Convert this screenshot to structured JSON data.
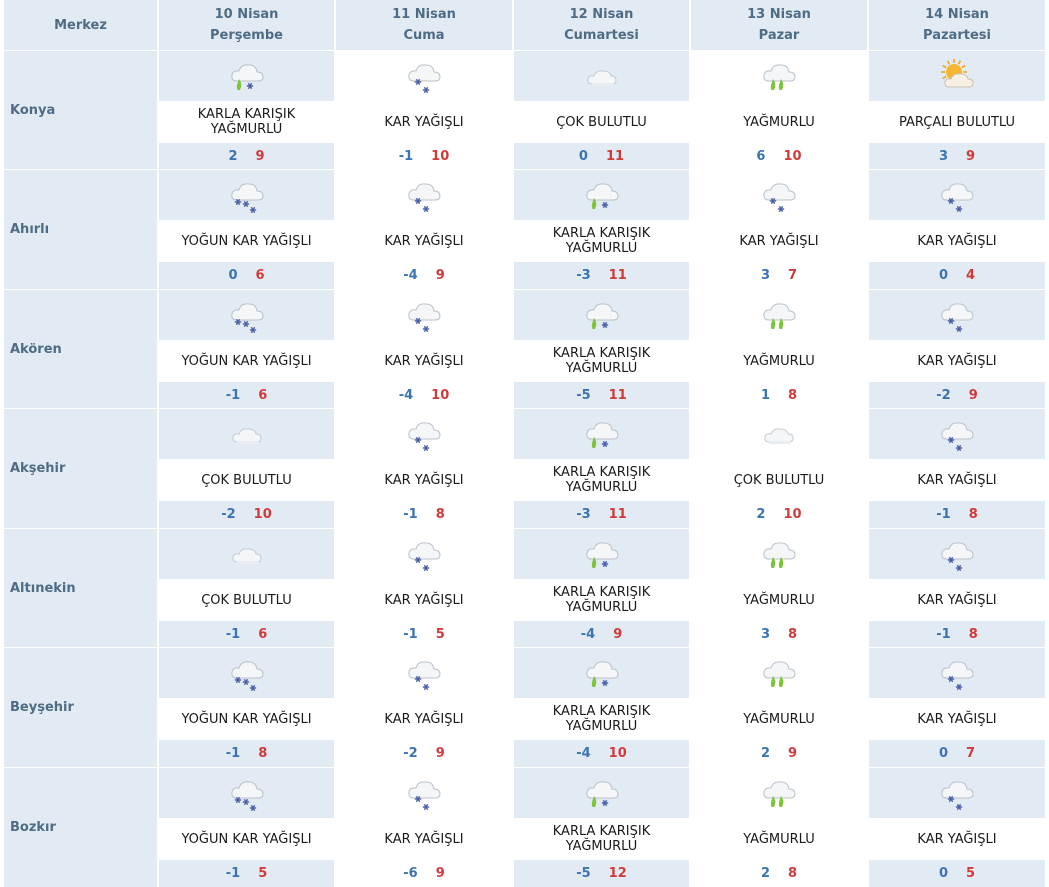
{
  "header": {
    "corner_label": "Merkez",
    "days": [
      {
        "date": "10 Nisan",
        "weekday": "Perşembe"
      },
      {
        "date": "11 Nisan",
        "weekday": "Cuma"
      },
      {
        "date": "12 Nisan",
        "weekday": "Cumartesi"
      },
      {
        "date": "13 Nisan",
        "weekday": "Pazar"
      },
      {
        "date": "14 Nisan",
        "weekday": "Pazartesi"
      }
    ]
  },
  "conditions": {
    "sleet": "KARLA KARIŞIK YAĞMURLU",
    "snow": "KAR YAĞIŞLI",
    "heavy_snow": "YOĞUN KAR YAĞIŞLI",
    "overcast": "ÇOK BULUTLU",
    "rain": "YAĞMURLU",
    "partly_cloudy": "PARÇALI BULUTLU"
  },
  "icons": {
    "sleet": "cloud-rain-snow-icon",
    "snow": "cloud-snow-icon",
    "heavy_snow": "cloud-heavy-snow-icon",
    "overcast": "cloud-icon",
    "rain": "cloud-rain-icon",
    "partly_cloudy": "sun-cloud-icon"
  },
  "colors": {
    "header_bg": "#e2ebf3",
    "header_text": "#4f6c86",
    "min_temp": "#3a74b3",
    "max_temp": "#d23a3a",
    "rain_drop": "#7cc43a",
    "snowflake": "#4a5fa6",
    "sun": "#f5a623"
  },
  "cities": [
    {
      "name": "Konya",
      "days": [
        {
          "cond": "KARLA KARIŞIK YAĞMURLU",
          "icon": "sleet",
          "min": "2",
          "max": "9"
        },
        {
          "cond": "KAR YAĞIŞLI",
          "icon": "snow",
          "min": "-1",
          "max": "10"
        },
        {
          "cond": "ÇOK BULUTLU",
          "icon": "overcast",
          "min": "0",
          "max": "11"
        },
        {
          "cond": "YAĞMURLU",
          "icon": "rain",
          "min": "6",
          "max": "10"
        },
        {
          "cond": "PARÇALI BULUTLU",
          "icon": "partly_cloudy",
          "min": "3",
          "max": "9"
        }
      ]
    },
    {
      "name": "Ahırlı",
      "days": [
        {
          "cond": "YOĞUN KAR YAĞIŞLI",
          "icon": "heavy_snow",
          "min": "0",
          "max": "6"
        },
        {
          "cond": "KAR YAĞIŞLI",
          "icon": "snow",
          "min": "-4",
          "max": "9"
        },
        {
          "cond": "KARLA KARIŞIK YAĞMURLU",
          "icon": "sleet",
          "min": "-3",
          "max": "11"
        },
        {
          "cond": "KAR YAĞIŞLI",
          "icon": "snow",
          "min": "3",
          "max": "7"
        },
        {
          "cond": "KAR YAĞIŞLI",
          "icon": "snow",
          "min": "0",
          "max": "4"
        }
      ]
    },
    {
      "name": "Akören",
      "days": [
        {
          "cond": "YOĞUN KAR YAĞIŞLI",
          "icon": "heavy_snow",
          "min": "-1",
          "max": "6"
        },
        {
          "cond": "KAR YAĞIŞLI",
          "icon": "snow",
          "min": "-4",
          "max": "10"
        },
        {
          "cond": "KARLA KARIŞIK YAĞMURLU",
          "icon": "sleet",
          "min": "-5",
          "max": "11"
        },
        {
          "cond": "YAĞMURLU",
          "icon": "rain",
          "min": "1",
          "max": "8"
        },
        {
          "cond": "KAR YAĞIŞLI",
          "icon": "snow",
          "min": "-2",
          "max": "9"
        }
      ]
    },
    {
      "name": "Akşehir",
      "days": [
        {
          "cond": "ÇOK BULUTLU",
          "icon": "overcast",
          "min": "-2",
          "max": "10"
        },
        {
          "cond": "KAR YAĞIŞLI",
          "icon": "snow",
          "min": "-1",
          "max": "8"
        },
        {
          "cond": "KARLA KARIŞIK YAĞMURLU",
          "icon": "sleet",
          "min": "-3",
          "max": "11"
        },
        {
          "cond": "ÇOK BULUTLU",
          "icon": "overcast",
          "min": "2",
          "max": "10"
        },
        {
          "cond": "KAR YAĞIŞLI",
          "icon": "snow",
          "min": "-1",
          "max": "8"
        }
      ]
    },
    {
      "name": "Altınekin",
      "days": [
        {
          "cond": "ÇOK BULUTLU",
          "icon": "overcast",
          "min": "-1",
          "max": "6"
        },
        {
          "cond": "KAR YAĞIŞLI",
          "icon": "snow",
          "min": "-1",
          "max": "5"
        },
        {
          "cond": "KARLA KARIŞIK YAĞMURLU",
          "icon": "sleet",
          "min": "-4",
          "max": "9"
        },
        {
          "cond": "YAĞMURLU",
          "icon": "rain",
          "min": "3",
          "max": "8"
        },
        {
          "cond": "KAR YAĞIŞLI",
          "icon": "snow",
          "min": "-1",
          "max": "8"
        }
      ]
    },
    {
      "name": "Beyşehir",
      "days": [
        {
          "cond": "YOĞUN KAR YAĞIŞLI",
          "icon": "heavy_snow",
          "min": "-1",
          "max": "8"
        },
        {
          "cond": "KAR YAĞIŞLI",
          "icon": "snow",
          "min": "-2",
          "max": "9"
        },
        {
          "cond": "KARLA KARIŞIK YAĞMURLU",
          "icon": "sleet",
          "min": "-4",
          "max": "10"
        },
        {
          "cond": "YAĞMURLU",
          "icon": "rain",
          "min": "2",
          "max": "9"
        },
        {
          "cond": "KAR YAĞIŞLI",
          "icon": "snow",
          "min": "0",
          "max": "7"
        }
      ]
    },
    {
      "name": "Bozkır",
      "days": [
        {
          "cond": "YOĞUN KAR YAĞIŞLI",
          "icon": "heavy_snow",
          "min": "-1",
          "max": "5"
        },
        {
          "cond": "KAR YAĞIŞLI",
          "icon": "snow",
          "min": "-6",
          "max": "9"
        },
        {
          "cond": "KARLA KARIŞIK YAĞMURLU",
          "icon": "sleet",
          "min": "-5",
          "max": "12"
        },
        {
          "cond": "YAĞMURLU",
          "icon": "rain",
          "min": "2",
          "max": "8"
        },
        {
          "cond": "KAR YAĞIŞLI",
          "icon": "snow",
          "min": "0",
          "max": "5"
        }
      ]
    }
  ]
}
